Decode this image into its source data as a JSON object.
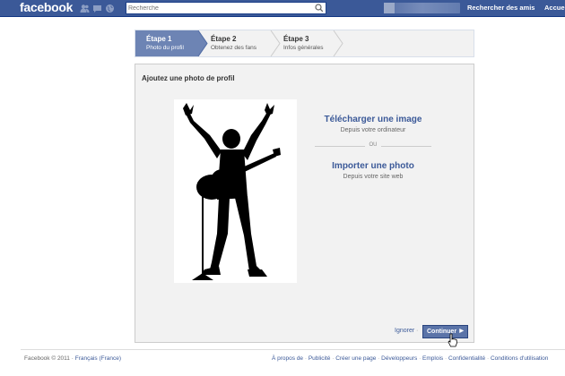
{
  "topbar": {
    "logo": "facebook",
    "search_placeholder": "Recherche",
    "links": [
      "Rechercher des amis",
      "Accue"
    ]
  },
  "steps": [
    {
      "title": "Étape 1",
      "subtitle": "Photo du profil",
      "active": true
    },
    {
      "title": "Étape 2",
      "subtitle": "Obtenez des fans",
      "active": false
    },
    {
      "title": "Étape 3",
      "subtitle": "Infos générales",
      "active": false
    }
  ],
  "panel": {
    "title": "Ajoutez une photo de profil",
    "upload_title": "Télécharger une image",
    "upload_sub": "Depuis votre ordinateur",
    "or": "OU",
    "import_title": "Importer une photo",
    "import_sub": "Depuis votre site web",
    "ignore": "Ignorer",
    "continue": "Continuer"
  },
  "footer": {
    "copyright": "Facebook © 2011 ·",
    "language": "Français (France)",
    "links": [
      "À propos de",
      "Publicité",
      "Créer une page",
      "Développeurs",
      "Emplois",
      "Confidentialité",
      "Conditions d'utilisation"
    ]
  },
  "colors": {
    "brand": "#3b5998",
    "button": "#5b74a8",
    "panel": "#f2f2f2"
  }
}
